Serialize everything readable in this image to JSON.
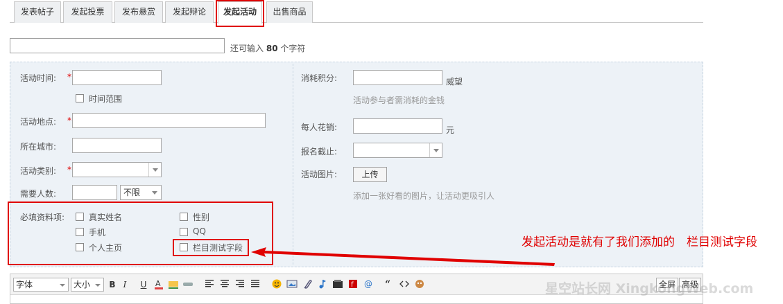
{
  "tabs": [
    {
      "label": "发表帖子"
    },
    {
      "label": "发起投票"
    },
    {
      "label": "发布悬赏"
    },
    {
      "label": "发起辩论"
    },
    {
      "label": "发起活动"
    },
    {
      "label": "出售商品"
    }
  ],
  "title": {
    "hint_prefix": "还可输入",
    "remaining": "80",
    "hint_suffix": "个字符"
  },
  "left": {
    "activity_time_label": "活动时间:",
    "time_range_label": "时间范围",
    "activity_location_label": "活动地点:",
    "city_label": "所在城市:",
    "category_label": "活动类别:",
    "people_label": "需要人数:",
    "people_limit": "不限",
    "required_label": "必填资料项:",
    "required_fields": [
      "真实姓名",
      "性别",
      "手机",
      "QQ",
      "个人主页",
      "栏目测试字段"
    ],
    "required_mark": "*"
  },
  "right": {
    "points_label": "消耗积分:",
    "points_unit": "威望",
    "points_hint": "活动参与者需消耗的金钱",
    "cost_label": "每人花销:",
    "cost_unit": "元",
    "deadline_label": "报名截止:",
    "image_label": "活动图片:",
    "upload_button": "上传",
    "image_hint": "添加一张好看的图片，让活动更吸引人"
  },
  "annotation": {
    "text": "发起活动是就有了我们添加的　栏目测试字段"
  },
  "editor": {
    "font_label": "字体",
    "size_label": "大小",
    "bold": "B",
    "italic": "I",
    "underline": "U",
    "fullscreen": "全屏",
    "advanced": "高级"
  },
  "watermark": "星空站长网 XingkongWeb.com",
  "colors": {
    "highlight": "#e00000",
    "form_bg": "#edf2f7"
  }
}
